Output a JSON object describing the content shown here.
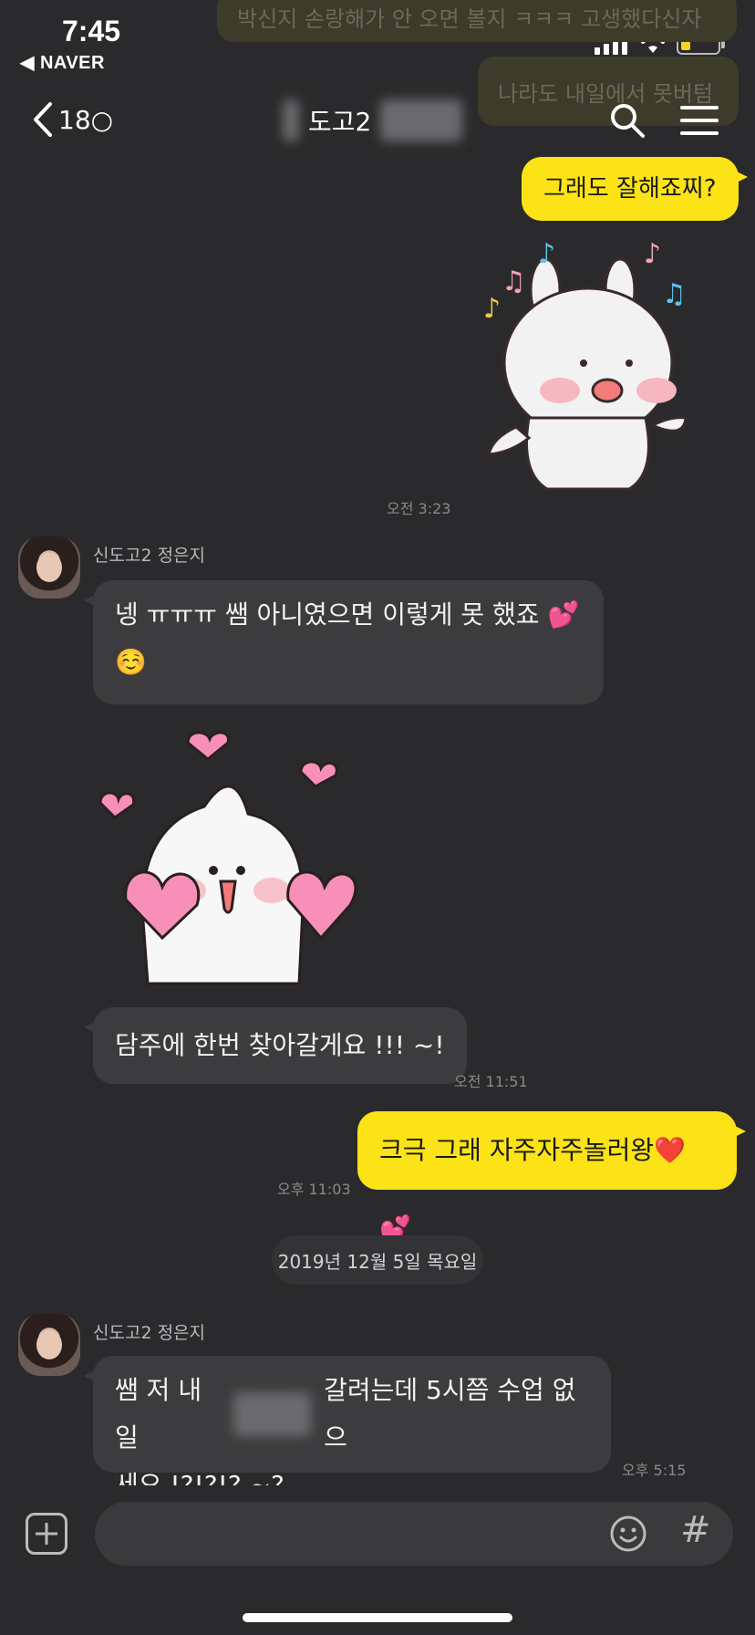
{
  "status_bar": {
    "time": "7:45",
    "back_app": "◀ NAVER"
  },
  "header": {
    "back_count": "18○",
    "title": "도고2",
    "search_icon": "search-icon",
    "menu_icon": "hamburger-menu-icon"
  },
  "colors": {
    "background": "#2a2a2c",
    "my_bubble": "#fbe318",
    "their_bubble": "#3c3c3e"
  },
  "faded_messages": [
    "박신지 손랑해가 안 오면 볼지 ㅋㅋㅋ 고생했다신자",
    "나라도 내일에서 못버텀"
  ],
  "messages": {
    "m1_text": "그래도 잘해죠찌?",
    "sticker1": "bunny-music-sticker",
    "ts1": "오전 3:23",
    "sender_name": "신도고2 정은지",
    "m2_line1": "넹 ㅠㅠㅠ 쌤 아니였으면  이렇게 못 했죠 💕",
    "m2_line2": "☺️",
    "sticker2": "bunny-hearts-sticker",
    "m3_text": "담주에 한번 찾아갈게요 !!! ~!",
    "ts3": "오전 11:51",
    "m4_text": "크극 그래 자주자주놀러왕❤️💕",
    "ts4": "오후 11:03",
    "date_divider": "2019년 12월 5일 목요일",
    "sender_name2": "신도고2 정은지",
    "m5_line1a": "쌤 저 내일",
    "m5_line1b": "갈려는데 5시쯤 수업 없으",
    "m5_line2": "세요 !?!?!? ~?",
    "ts5": "오후 5:15"
  },
  "composer": {
    "placeholder": "",
    "plus_icon": "plus-icon",
    "emoji_icon": "emoji-icon",
    "hash_icon": "#"
  }
}
